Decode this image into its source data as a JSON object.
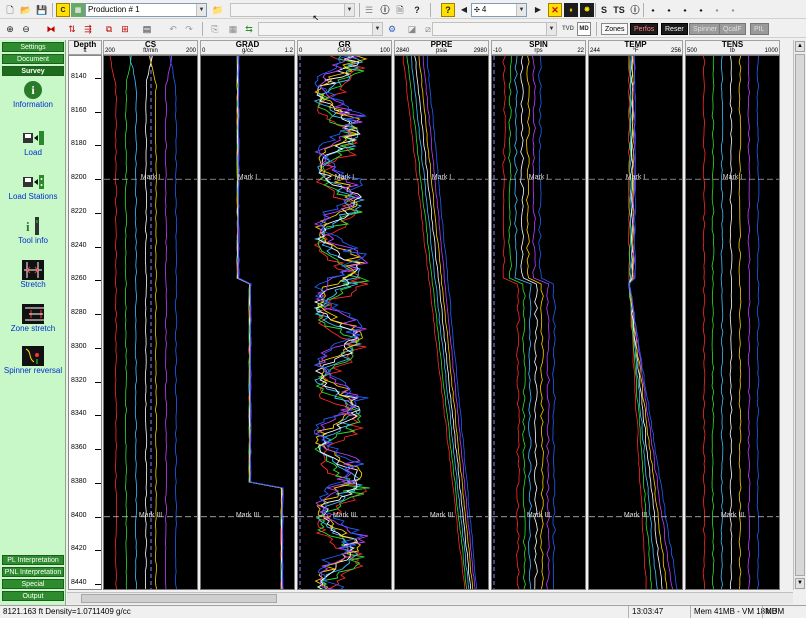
{
  "toolbar1": {
    "production_combo": "Production # 1",
    "empty_combo": "",
    "page_number": "4",
    "s_label": "S",
    "ts_label": "TS"
  },
  "toolbar2": {
    "tvd_label": "TVD",
    "md_label": "MD",
    "filters": [
      "Zones",
      "Perfos",
      "Reser",
      "Spinner",
      "QcalF",
      "PIL"
    ]
  },
  "sidebar": {
    "top_buttons": [
      "Settings",
      "Document",
      "Survey"
    ],
    "tools": [
      {
        "label": "Information",
        "icon": "info-icon"
      },
      {
        "label": "Load",
        "icon": "load-icon"
      },
      {
        "label": "Load Stations",
        "icon": "load-stations-icon"
      },
      {
        "label": "Tool info",
        "icon": "tool-info-icon"
      },
      {
        "label": "Stretch",
        "icon": "stretch-icon"
      },
      {
        "label": "Zone stretch",
        "icon": "zone-stretch-icon"
      },
      {
        "label": "Spinner reversal",
        "icon": "spinner-reversal-icon"
      }
    ],
    "bottom_buttons": [
      "PL Interpretation",
      "PNL Interpretation",
      "Special",
      "Output"
    ]
  },
  "depth": {
    "title": "Depth",
    "unit": "ft",
    "ticks": [
      8140,
      8160,
      8180,
      8200,
      8220,
      8240,
      8260,
      8280,
      8300,
      8320,
      8340,
      8360,
      8380,
      8400,
      8420,
      8440
    ],
    "range": [
      8127,
      8444
    ]
  },
  "marks": [
    {
      "label": "Mark I",
      "depth": 8200
    },
    {
      "label": "Mark III",
      "depth": 8400
    }
  ],
  "tracks": [
    {
      "name": "CS",
      "min": "200",
      "unit": "ft/min",
      "max": "200"
    },
    {
      "name": "GRAD",
      "min": "0",
      "unit": "g/cc",
      "max": "1.2"
    },
    {
      "name": "GR",
      "min": "0",
      "unit": "GAPI",
      "max": "100"
    },
    {
      "name": "PPRE",
      "min": "2840",
      "unit": "psia",
      "max": "2980"
    },
    {
      "name": "SPIN",
      "min": "-10",
      "unit": "rps",
      "max": "22"
    },
    {
      "name": "TEMP",
      "min": "244",
      "unit": "°F",
      "max": "256"
    },
    {
      "name": "TENS",
      "min": "500",
      "unit": "lb",
      "max": "1000"
    }
  ],
  "curve_colors": [
    "#ff2a2a",
    "#30e030",
    "#40c0ff",
    "#ffffff",
    "#ffd000",
    "#c040ff",
    "#2060ff"
  ],
  "status": {
    "readout": "8121.163 ft Density=1.0711409 g/cc",
    "time": "13:03:47",
    "memory": "Mem 41MB - VM 18MB",
    "num": "NUM"
  }
}
